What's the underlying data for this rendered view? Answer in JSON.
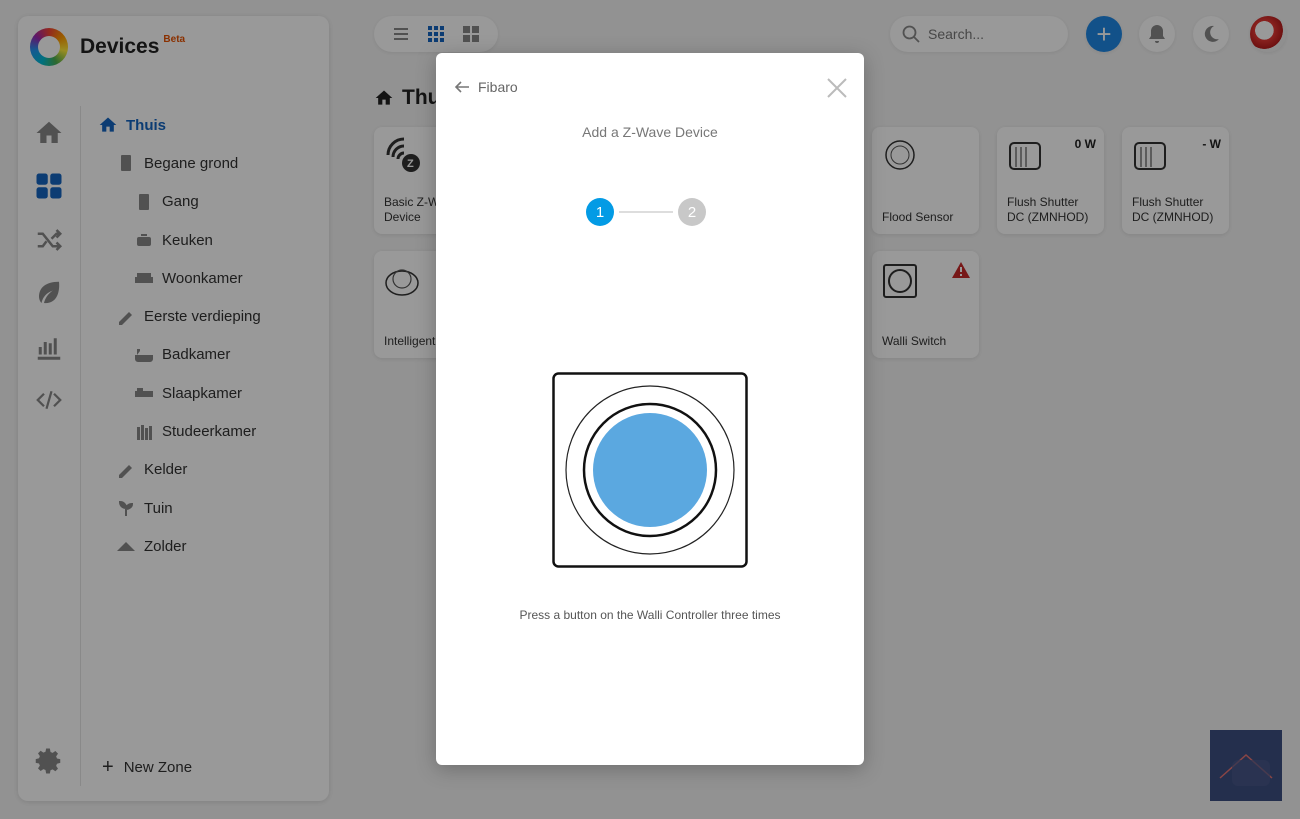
{
  "brand": {
    "title": "Devices",
    "badge": "Beta"
  },
  "rail": [
    {
      "name": "home-icon",
      "active": false
    },
    {
      "name": "dashboard-grid-icon",
      "active": true
    },
    {
      "name": "shuffle-icon",
      "active": false
    },
    {
      "name": "leaf-icon",
      "active": false
    },
    {
      "name": "bar-chart-icon",
      "active": false
    },
    {
      "name": "code-icon",
      "active": false
    }
  ],
  "zones": [
    {
      "label": "Thuis",
      "level": 0,
      "active": true,
      "icon": "home-icon"
    },
    {
      "label": "Begane grond",
      "level": 1,
      "icon": "floor-icon"
    },
    {
      "label": "Gang",
      "level": 2,
      "icon": "door-icon"
    },
    {
      "label": "Keuken",
      "level": 2,
      "icon": "pot-icon"
    },
    {
      "label": "Woonkamer",
      "level": 2,
      "icon": "sofa-icon"
    },
    {
      "label": "Eerste verdieping",
      "level": 1,
      "icon": "floor-icon"
    },
    {
      "label": "Badkamer",
      "level": 2,
      "icon": "bathtub-icon"
    },
    {
      "label": "Slaapkamer",
      "level": 2,
      "icon": "bed-icon"
    },
    {
      "label": "Studeerkamer",
      "level": 2,
      "icon": "books-icon"
    },
    {
      "label": "Kelder",
      "level": 1,
      "icon": "floor-icon"
    },
    {
      "label": "Tuin",
      "level": 1,
      "icon": "plant-icon"
    },
    {
      "label": "Zolder",
      "level": 1,
      "icon": "roof-icon"
    }
  ],
  "new_zone_label": "New Zone",
  "search": {
    "placeholder": "Search..."
  },
  "add_label": "+",
  "page": {
    "title": "Thuis"
  },
  "devices": [
    {
      "name": "Basic Z-Wave Device",
      "value": ""
    },
    {
      "name": "Flood Sensor",
      "value": ""
    },
    {
      "name": "Flush Shutter DC (ZMNHOD)",
      "value": "0 W"
    },
    {
      "name": "Flush Shutter DC (ZMNHOD)",
      "value": "- W"
    },
    {
      "name": "Intelligent Alarm",
      "value": ""
    },
    {
      "name": "Walli Switch",
      "value": "",
      "warning": true
    }
  ],
  "modal": {
    "back_label": "Fibaro",
    "title": "Add a Z-Wave Device",
    "steps": [
      "1",
      "2"
    ],
    "current_step": 1,
    "instruction": "Press a button on the Walli Controller three times"
  },
  "colors": {
    "accent": "#039be5",
    "active_nav": "#1565c0",
    "button_fill": "#5ba8e0",
    "add_button": "#1e88e5"
  }
}
